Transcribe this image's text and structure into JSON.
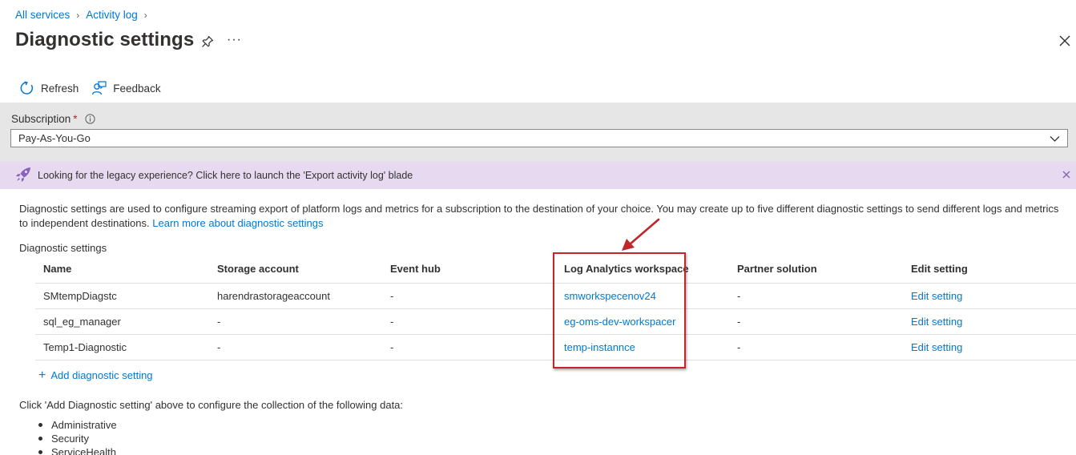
{
  "breadcrumb": [
    "All services",
    "Activity log"
  ],
  "page": {
    "title": "Diagnostic settings",
    "more": "···"
  },
  "toolbar": {
    "refresh": "Refresh",
    "feedback": "Feedback"
  },
  "subscription": {
    "label": "Subscription",
    "required_marker": "*",
    "value": "Pay-As-You-Go"
  },
  "banner": {
    "text": "Looking for the legacy experience? Click here to launch the 'Export activity log' blade"
  },
  "description": {
    "text": "Diagnostic settings are used to configure streaming export of platform logs and metrics for a subscription to the destination of your choice. You may create up to five different diagnostic settings to send different logs and metrics to independent destinations.",
    "link": "Learn more about diagnostic settings"
  },
  "table": {
    "heading": "Diagnostic settings",
    "columns": [
      "Name",
      "Storage account",
      "Event hub",
      "Log Analytics workspace",
      "Partner solution",
      "Edit setting"
    ],
    "rows": [
      [
        "SMtempDiagstc",
        "harendrastorageaccount",
        "-",
        "smworkspecenov24",
        "-",
        "Edit setting"
      ],
      [
        "sql_eg_manager",
        "-",
        "-",
        "eg-oms-dev-workspacer",
        "-",
        "Edit setting"
      ],
      [
        "Temp1-Diagnostic",
        "-",
        "-",
        "temp-instannce",
        "-",
        "Edit setting"
      ]
    ]
  },
  "add_setting": {
    "plus": "+",
    "label": "Add diagnostic setting"
  },
  "collect": {
    "text": "Click 'Add Diagnostic setting' above to configure the collection of the following data:",
    "items": [
      "Administrative",
      "Security",
      "ServiceHealth"
    ]
  },
  "colors": {
    "accent": "#0078d4",
    "banner": "#e7d9ef",
    "highlight": "#c2262b"
  }
}
